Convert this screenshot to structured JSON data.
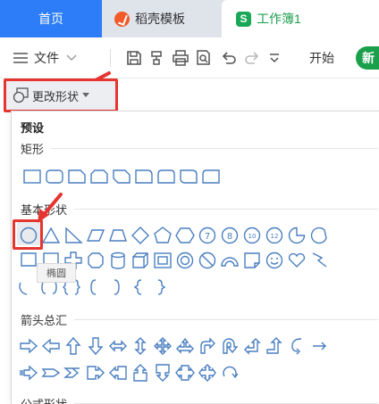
{
  "tabs": {
    "home": "首页",
    "template": "稻壳模板",
    "doc": "工作簿1",
    "doc_badge": "S"
  },
  "toolbar": {
    "menu_label": "文件",
    "start_label": "开始",
    "start_badge": "新"
  },
  "shape_button": {
    "label": "更改形状"
  },
  "dropdown": {
    "title": "预设",
    "sections": {
      "rect": "矩形",
      "basic": "基本形状",
      "arrow": "箭头总汇",
      "formula": "公式形状"
    },
    "tooltip": "椭圆"
  },
  "colors": {
    "accent": "#2c7df7",
    "sheet_green": "#1a9f4b",
    "highlight_red": "#e53530",
    "shape_stroke": "#4a7fc1"
  }
}
